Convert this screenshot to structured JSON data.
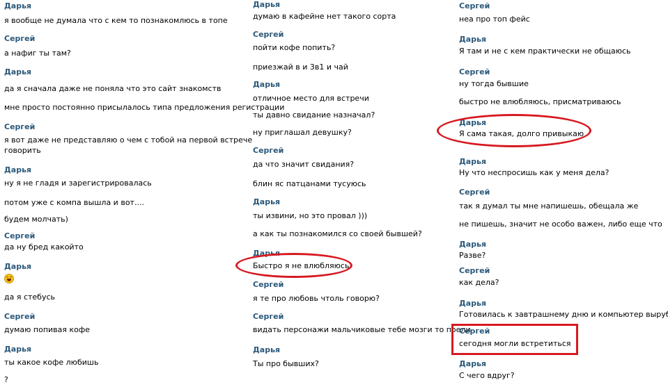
{
  "colors": {
    "author": "#2b587a",
    "highlight": "#d71920"
  },
  "columns": [
    {
      "lines": [
        {
          "type": "author",
          "text": "Дарья"
        },
        {
          "type": "msg",
          "text": "я вообще не думала что с кем то познакомлюсь в топе"
        },
        {
          "type": "author",
          "text": "Сергей"
        },
        {
          "type": "msg",
          "text": "а нафиг ты там?"
        },
        {
          "type": "author",
          "text": "Дарья"
        },
        {
          "type": "msg",
          "text": "да я сначала даже не поняла что это сайт знакомств"
        },
        {
          "type": "msg",
          "text": "мне просто постоянно присылалось типа предложения регистрации"
        },
        {
          "type": "author",
          "text": "Сергей"
        },
        {
          "type": "msg",
          "text": "я вот даже не представляю о чем с тобой на первой встрече"
        },
        {
          "type": "msg",
          "text": "говорить"
        },
        {
          "type": "author",
          "text": "Дарья"
        },
        {
          "type": "msg",
          "text": "ну я не гладя и зарегистрировалась"
        },
        {
          "type": "msg",
          "text": "потом уже с компа вышла и вот...."
        },
        {
          "type": "msg",
          "text": "будем молчать)"
        },
        {
          "type": "author",
          "text": "Сергей"
        },
        {
          "type": "msg",
          "text": "да ну бред какойто"
        },
        {
          "type": "author",
          "text": "Дарья"
        },
        {
          "type": "emoji",
          "text": "laughing-face-icon"
        },
        {
          "type": "msg",
          "text": "да я стебусь"
        },
        {
          "type": "author",
          "text": "Сергей"
        },
        {
          "type": "msg",
          "text": "думаю попивая кофе"
        },
        {
          "type": "author",
          "text": "Дарья"
        },
        {
          "type": "msg",
          "text": "ты какое кофе любишь"
        },
        {
          "type": "msg",
          "text": "?"
        }
      ]
    },
    {
      "lines": [
        {
          "type": "author",
          "text": "Дарья"
        },
        {
          "type": "msg",
          "text": "думаю в кафейне нет такого сорта"
        },
        {
          "type": "author",
          "text": "Сергей"
        },
        {
          "type": "msg",
          "text": "пойти кофе попить?"
        },
        {
          "type": "msg",
          "text": "приезжай в                    и 3в1 и чай"
        },
        {
          "type": "author",
          "text": "Дарья"
        },
        {
          "type": "msg",
          "text": "отличное место для встречи"
        },
        {
          "type": "msg",
          "text": "ты давно свидание назначал?"
        },
        {
          "type": "msg",
          "text": "ну приглашал девушку?"
        },
        {
          "type": "author",
          "text": "Сергей"
        },
        {
          "type": "msg",
          "text": "да что значит свидания?"
        },
        {
          "type": "msg",
          "text": "блин яс патцанами тусуюсь"
        },
        {
          "type": "author",
          "text": "Дарья"
        },
        {
          "type": "msg",
          "text": "ты извини, но это провал    )))"
        },
        {
          "type": "msg",
          "text": "а как ты познакомился со своей бывшей?"
        },
        {
          "type": "author",
          "text": "Дарья"
        },
        {
          "type": "msg",
          "text": "Быстро я не влюбляюсь"
        },
        {
          "type": "author",
          "text": "Сергей"
        },
        {
          "type": "msg",
          "text": "я те про любовь чтоль говорю?"
        },
        {
          "type": "author",
          "text": "Сергей"
        },
        {
          "type": "msg",
          "text": "видать персонажи мальчиковые тебе мозги то поели"
        },
        {
          "type": "author",
          "text": "Дарья"
        },
        {
          "type": "msg",
          "text": "Ты про бывших?"
        }
      ]
    },
    {
      "lines": [
        {
          "type": "author",
          "text": "Сергей"
        },
        {
          "type": "msg",
          "text": "неа про топ фейс"
        },
        {
          "type": "author",
          "text": "Дарья"
        },
        {
          "type": "msg",
          "text": "Я там и не с кем практически не общаюсь"
        },
        {
          "type": "author",
          "text": "Сергей"
        },
        {
          "type": "msg",
          "text": "ну тогда бывшие"
        },
        {
          "type": "msg",
          "text": "быстро не влюбляюсь, присматриваюсь"
        },
        {
          "type": "author",
          "text": "Дарья"
        },
        {
          "type": "msg",
          "text": "Я сама такая, долго привыкаю"
        },
        {
          "type": "author",
          "text": "Дарья"
        },
        {
          "type": "msg",
          "text": "Ну что неспросишь как у меня дела?"
        },
        {
          "type": "author",
          "text": "Сергей"
        },
        {
          "type": "msg",
          "text": "так я думал ты мне напишешь, обещала же"
        },
        {
          "type": "msg",
          "text": "не пишешь, значит не особо важен, либо еще что"
        },
        {
          "type": "author",
          "text": "Дарья"
        },
        {
          "type": "msg",
          "text": "Разве?"
        },
        {
          "type": "author",
          "text": "Сергей"
        },
        {
          "type": "msg",
          "text": "как дела?"
        },
        {
          "type": "author",
          "text": "Дарья"
        },
        {
          "type": "msg",
          "text": "Готовилась к завтрашнему дню и компьютер вырубился"
        },
        {
          "type": "author",
          "text": "Сергей"
        },
        {
          "type": "msg",
          "text": "сегодня могли встретиться"
        },
        {
          "type": "author",
          "text": "Дарья"
        },
        {
          "type": "msg",
          "text": "С чего вдруг?"
        }
      ]
    }
  ]
}
